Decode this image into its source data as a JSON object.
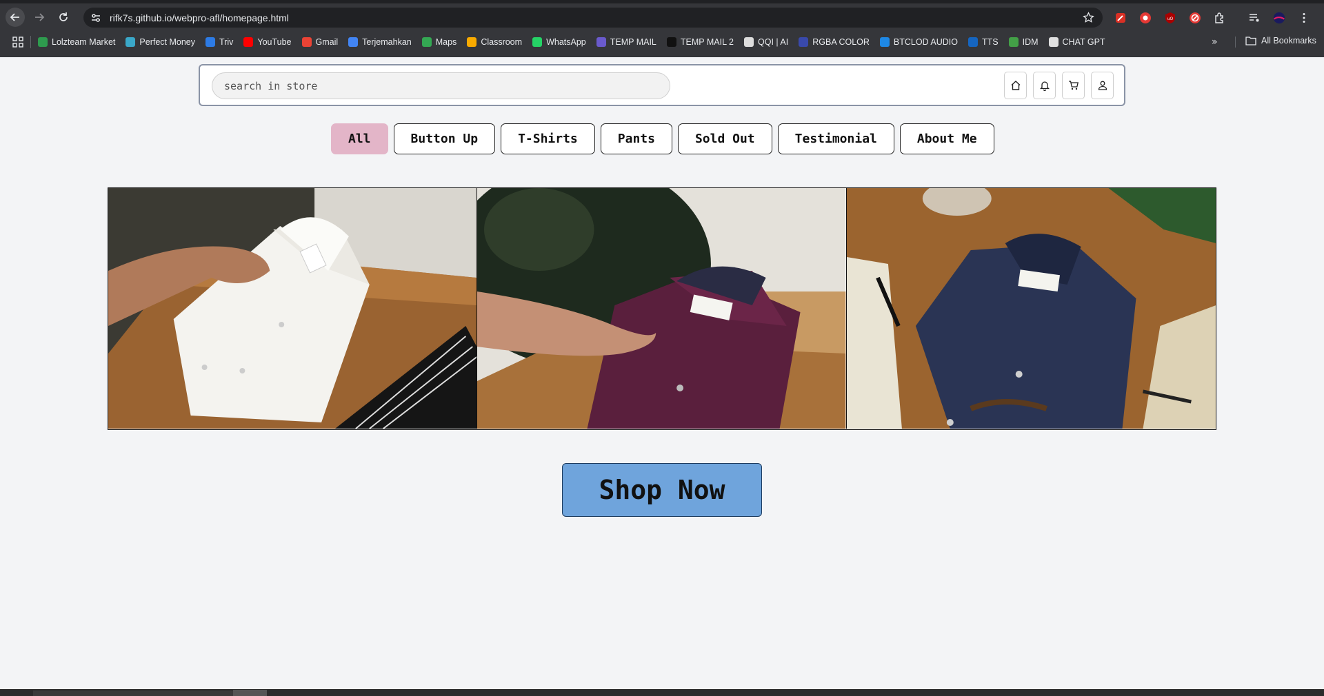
{
  "browser": {
    "url": "rifk7s.github.io/webpro-afl/homepage.html",
    "bookmarks": [
      {
        "label": "Lolzteam Market",
        "color": "#2e9b4e"
      },
      {
        "label": "Perfect Money",
        "color": "#3aa8c9"
      },
      {
        "label": "Triv",
        "color": "#2d7be5"
      },
      {
        "label": "YouTube",
        "color": "#ff0000"
      },
      {
        "label": "Gmail",
        "color": "#ea4335"
      },
      {
        "label": "Terjemahkan",
        "color": "#4285f4"
      },
      {
        "label": "Maps",
        "color": "#34a853"
      },
      {
        "label": "Classroom",
        "color": "#f9ab00"
      },
      {
        "label": "WhatsApp",
        "color": "#25d366"
      },
      {
        "label": "TEMP MAIL",
        "color": "#6a5acd"
      },
      {
        "label": "TEMP MAIL 2",
        "color": "#111111"
      },
      {
        "label": "QQI | AI",
        "color": "#dddddd"
      },
      {
        "label": "RGBA COLOR",
        "color": "#3949ab"
      },
      {
        "label": "BTCLOD AUDIO",
        "color": "#1e88e5"
      },
      {
        "label": "TTS",
        "color": "#1565c0"
      },
      {
        "label": "IDM",
        "color": "#43a047"
      },
      {
        "label": "CHAT GPT",
        "color": "#e0e0e0"
      }
    ],
    "more_bookmarks": "»",
    "all_bookmarks": "All Bookmarks"
  },
  "store": {
    "search_placeholder": "search in store",
    "header_icons": [
      "home-icon",
      "bell-icon",
      "cart-icon",
      "user-icon"
    ],
    "tabs": [
      {
        "label": "All",
        "active": true
      },
      {
        "label": "Button Up",
        "active": false
      },
      {
        "label": "T-Shirts",
        "active": false
      },
      {
        "label": "Pants",
        "active": false
      },
      {
        "label": "Sold Out",
        "active": false
      },
      {
        "label": "Testimonial",
        "active": false
      },
      {
        "label": "About Me",
        "active": false
      }
    ],
    "shop_button": "Shop Now",
    "colors": {
      "active_tab": "#e3b5c8",
      "shop_button": "#6fa4dc",
      "background": "#f3f4f6"
    }
  }
}
